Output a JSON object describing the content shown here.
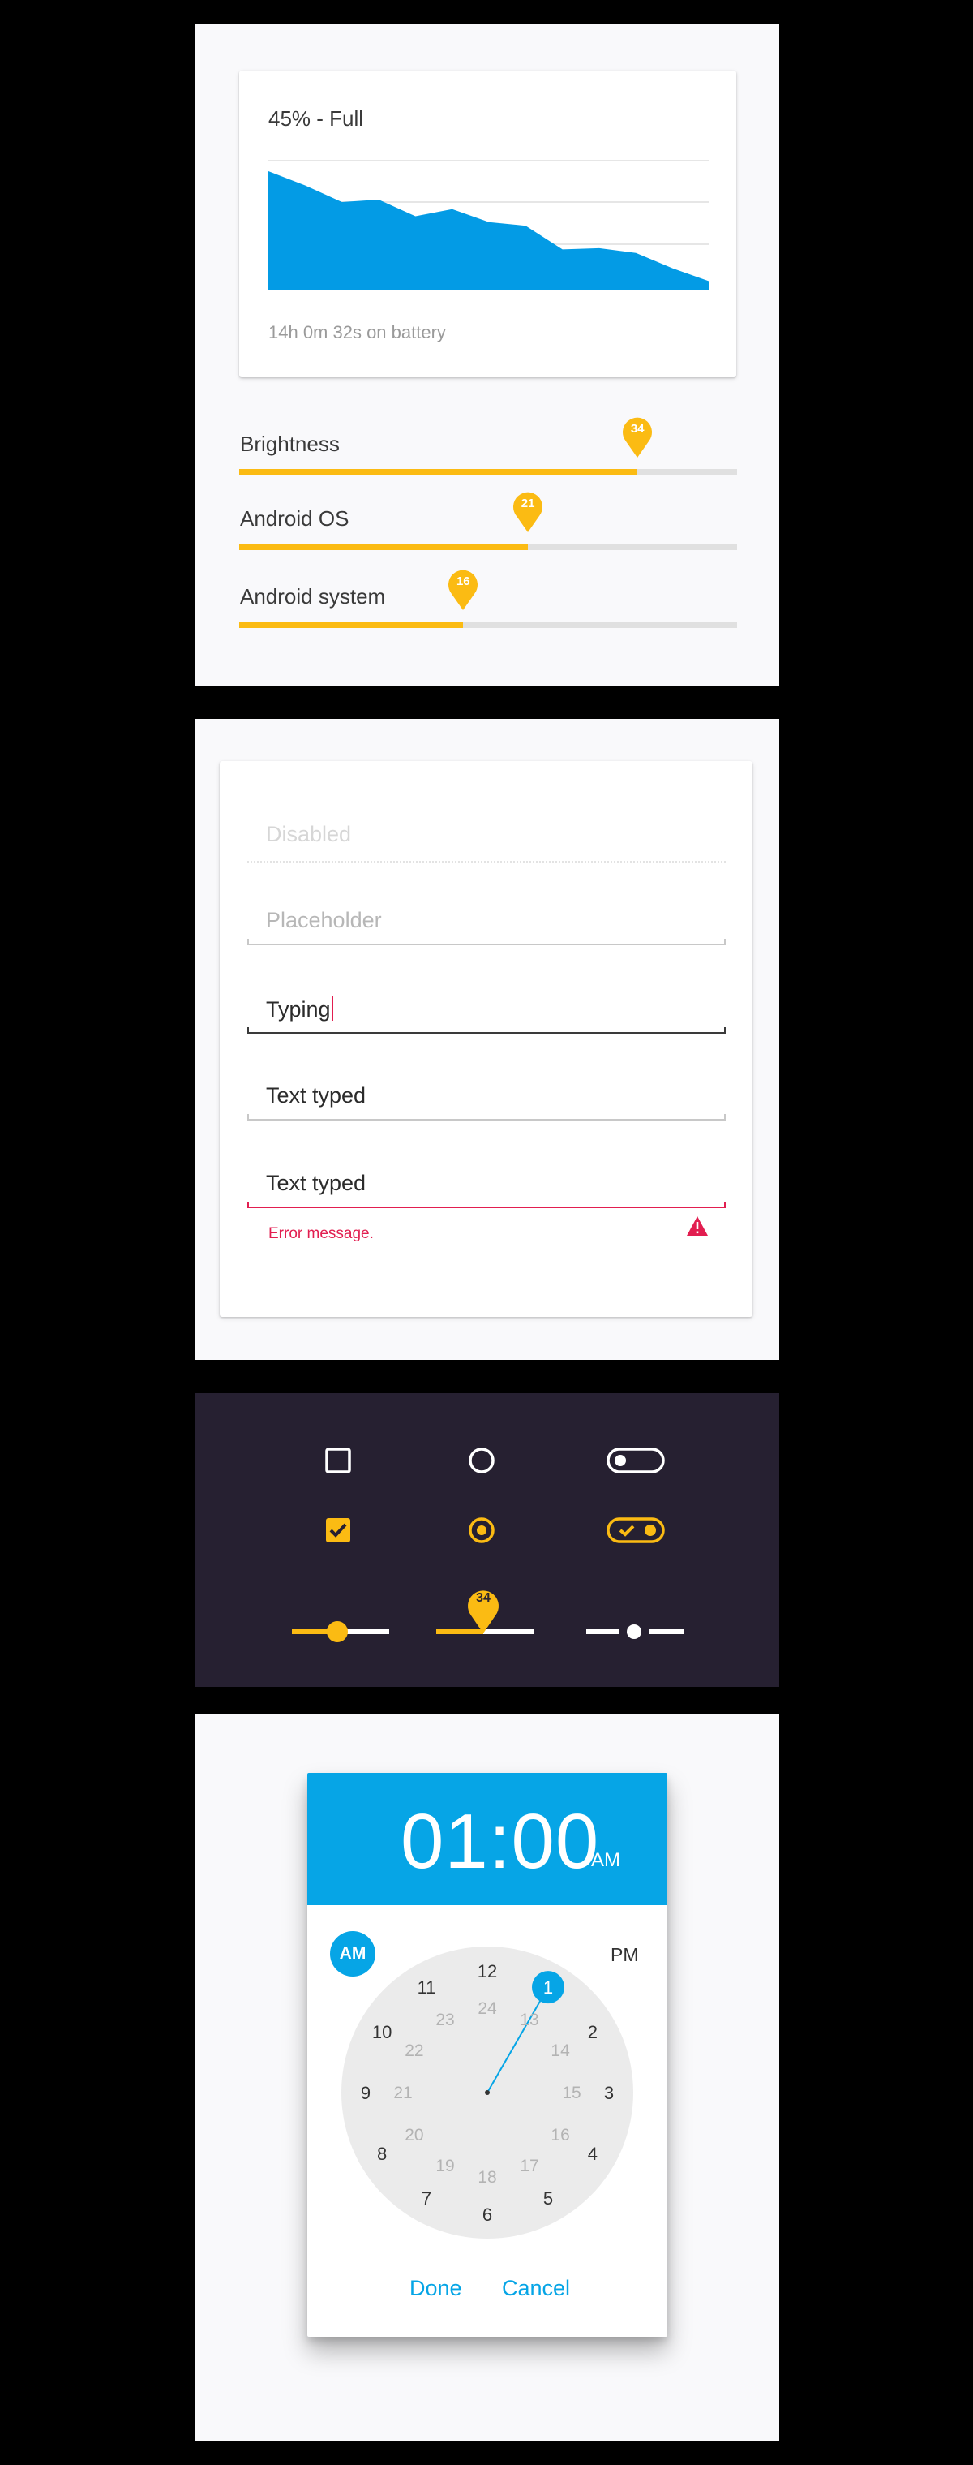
{
  "battery": {
    "title": "45% - Full",
    "subtitle": "14h 0m 32s on battery",
    "chart_data": {
      "type": "area",
      "values": [
        100,
        88,
        74,
        76,
        62,
        68,
        57,
        54,
        34,
        35,
        31,
        18,
        7
      ],
      "color": "#039be5",
      "grid": true
    },
    "sliders": [
      {
        "label": "Brightness",
        "value": 34,
        "fraction": 0.8
      },
      {
        "label": "Android OS",
        "value": 21,
        "fraction": 0.58
      },
      {
        "label": "Android system",
        "value": 16,
        "fraction": 0.45
      }
    ]
  },
  "fields": {
    "disabled": "Disabled",
    "placeholder": "Placeholder",
    "typing": "Typing",
    "typed": "Text typed",
    "error_value": "Text typed",
    "error_message": "Error message."
  },
  "controls": {
    "pin_value": "34",
    "accent": "#fbbb13"
  },
  "time_picker": {
    "time": "01:00",
    "period": "AM",
    "am_label": "AM",
    "pm_label": "PM",
    "outer_hours": [
      "12",
      "1",
      "2",
      "3",
      "4",
      "5",
      "6",
      "7",
      "8",
      "9",
      "10",
      "11"
    ],
    "inner_hours": [
      "24",
      "13",
      "14",
      "15",
      "16",
      "17",
      "18",
      "19",
      "20",
      "21",
      "22",
      "23"
    ],
    "done_label": "Done",
    "cancel_label": "Cancel",
    "accent": "#06a5e6"
  }
}
